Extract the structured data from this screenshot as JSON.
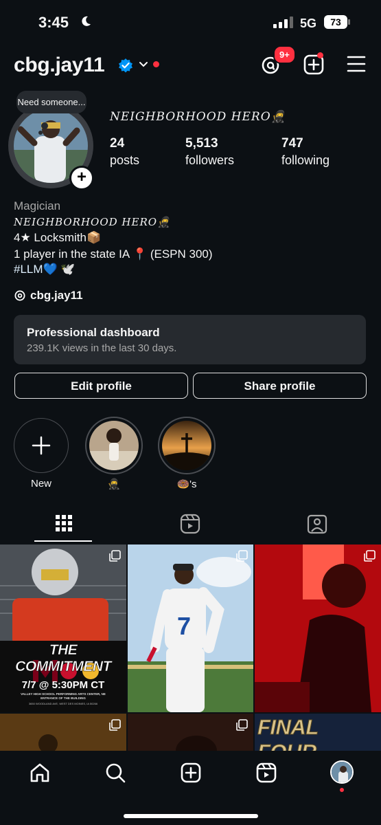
{
  "status_bar": {
    "time": "3:45",
    "network": "5G",
    "battery": "73"
  },
  "header": {
    "username": "cbg.jay11",
    "notifications_badge": "9+"
  },
  "profile": {
    "note": "Need someone...",
    "display_name": "NEIGHBORHOOD HERO🥷",
    "stats": [
      {
        "value": "24",
        "label": "posts"
      },
      {
        "value": "5,513",
        "label": "followers"
      },
      {
        "value": "747",
        "label": "following"
      }
    ],
    "category": "Magician",
    "bio_lines": [
      "NEIGHBORHOOD HERO🥷",
      "4★ Locksmith📦",
      "1 player in the state IA 📍 (ESPN 300)",
      "#LLM💙 🕊️"
    ],
    "threads_handle": "cbg.jay11"
  },
  "dashboard": {
    "title": "Professional dashboard",
    "subtitle": "239.1K views in the last 30 days."
  },
  "buttons": {
    "edit": "Edit profile",
    "share": "Share profile"
  },
  "highlights": [
    {
      "label": "New"
    },
    {
      "label": "🥷"
    },
    {
      "label": "🍩's"
    }
  ],
  "posts": {
    "commitment_title": "THE COMMITMENT",
    "commitment_date": "7/7 @ 5:30PM CT",
    "commitment_venue": "VALLEY HIGH SCHOOL PERFORMING ARTS CENTER, NE ENTRANCE OF THE BUILDING",
    "commitment_address": "3650 WOODLAND AVE, WEST DES MOINES, IA 50266",
    "final_four": "FINAL FOUR",
    "jersey_number": "7"
  },
  "colors": {
    "background": "#0c1014",
    "accent_red": "#ff3040",
    "verified_blue": "#0095f6",
    "hashtag_blue": "#e0f1ff"
  }
}
